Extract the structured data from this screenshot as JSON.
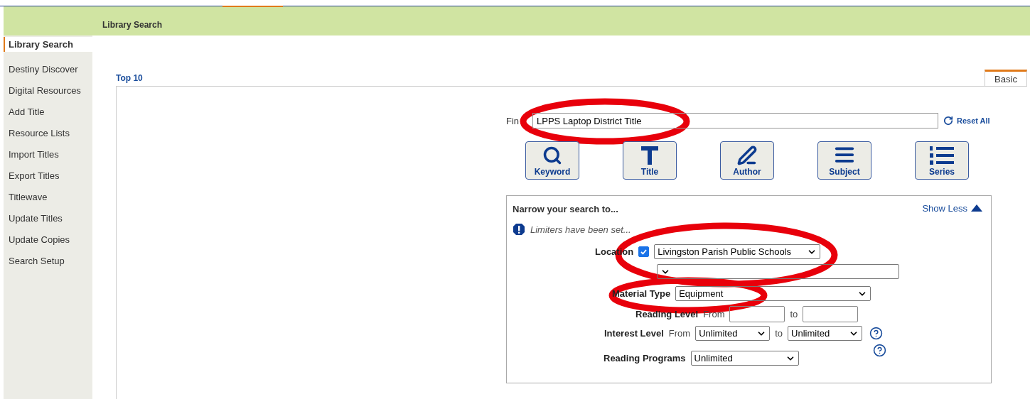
{
  "header": {
    "title": "Library Search"
  },
  "sidebar": {
    "items": [
      {
        "label": "Library Search",
        "selected": true
      },
      {
        "label": "Destiny Discover",
        "selected": false
      },
      {
        "label": "Digital Resources",
        "selected": false
      },
      {
        "label": "Add Title",
        "selected": false
      },
      {
        "label": "Resource Lists",
        "selected": false
      },
      {
        "label": "Import Titles",
        "selected": false
      },
      {
        "label": "Export Titles",
        "selected": false
      },
      {
        "label": "Titlewave",
        "selected": false
      },
      {
        "label": "Update Titles",
        "selected": false
      },
      {
        "label": "Update Copies",
        "selected": false
      },
      {
        "label": "Search Setup",
        "selected": false
      }
    ]
  },
  "top_link": "Top 10",
  "tabs": [
    {
      "label": "Basic",
      "selected": true
    }
  ],
  "search": {
    "label": "Fin",
    "value": "LPPS Laptop District Title",
    "reset": "Reset All"
  },
  "search_buttons": [
    {
      "label": "Keyword",
      "kind": "keyword"
    },
    {
      "label": "Title",
      "kind": "title"
    },
    {
      "label": "Author",
      "kind": "author"
    },
    {
      "label": "Subject",
      "kind": "subject"
    },
    {
      "label": "Series",
      "kind": "series"
    }
  ],
  "narrow": {
    "title": "Narrow your search to...",
    "toggle": "Show Less",
    "notice": "Limiters have been set...",
    "rows": [
      {
        "kind": "location",
        "label": "Location",
        "checked": true,
        "value": "Livingston Parish Public Schools"
      },
      {
        "kind": "subselect"
      },
      {
        "kind": "select",
        "label": "Material Type",
        "value": "Equipment"
      },
      {
        "kind": "range_text",
        "label": "Reading Level",
        "from": "From",
        "to": "to"
      },
      {
        "kind": "range_select",
        "label": "Interest Level",
        "from": "From",
        "from_value": "Unlimited",
        "to": "to",
        "to_value": "Unlimited",
        "help": true
      },
      {
        "kind": "select",
        "label": "Reading Programs",
        "value": "Unlimited",
        "help": true
      }
    ]
  }
}
